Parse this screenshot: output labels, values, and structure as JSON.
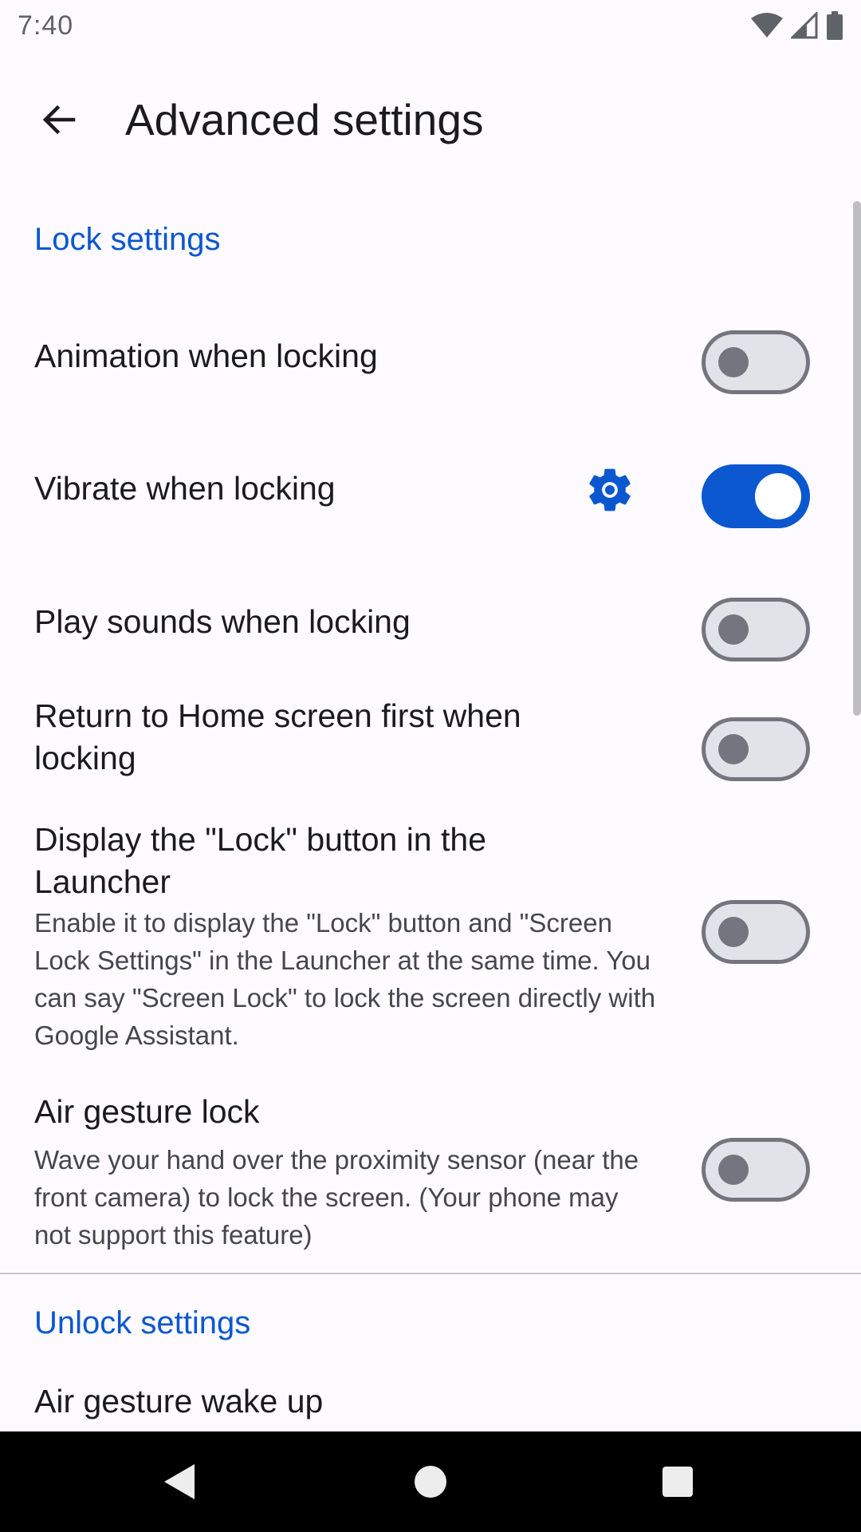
{
  "status_bar": {
    "time": "7:40"
  },
  "app_bar": {
    "title": "Advanced settings"
  },
  "sections": {
    "lock": {
      "header": "Lock settings"
    },
    "unlock": {
      "header": "Unlock settings"
    }
  },
  "items": [
    {
      "title": "Animation when locking",
      "checked": false
    },
    {
      "title": "Vibrate when locking",
      "checked": true
    },
    {
      "title": "Play sounds when locking",
      "checked": false
    },
    {
      "title": "Return to Home screen first when locking",
      "checked": false
    },
    {
      "title": "Display the \"Lock\" button in the Launcher",
      "summary": "Enable it to display the \"Lock\" button and \"Screen Lock Settings\" in the Launcher at the same time. You can say \"Screen Lock\" to lock the screen directly with Google Assistant.",
      "checked": false
    },
    {
      "title": "Air gesture lock",
      "summary": "Wave your hand over the proximity sensor (near the front camera) to lock the screen. (Your phone may not support this feature)",
      "checked": false
    },
    {
      "title": "Air gesture wake up"
    }
  ],
  "colors": {
    "accent": "#0B57D0",
    "switch_off": "#75757F",
    "background": "#FDFBFF"
  },
  "icons": {
    "back": "arrow-back-icon",
    "settings": "gear-icon"
  }
}
